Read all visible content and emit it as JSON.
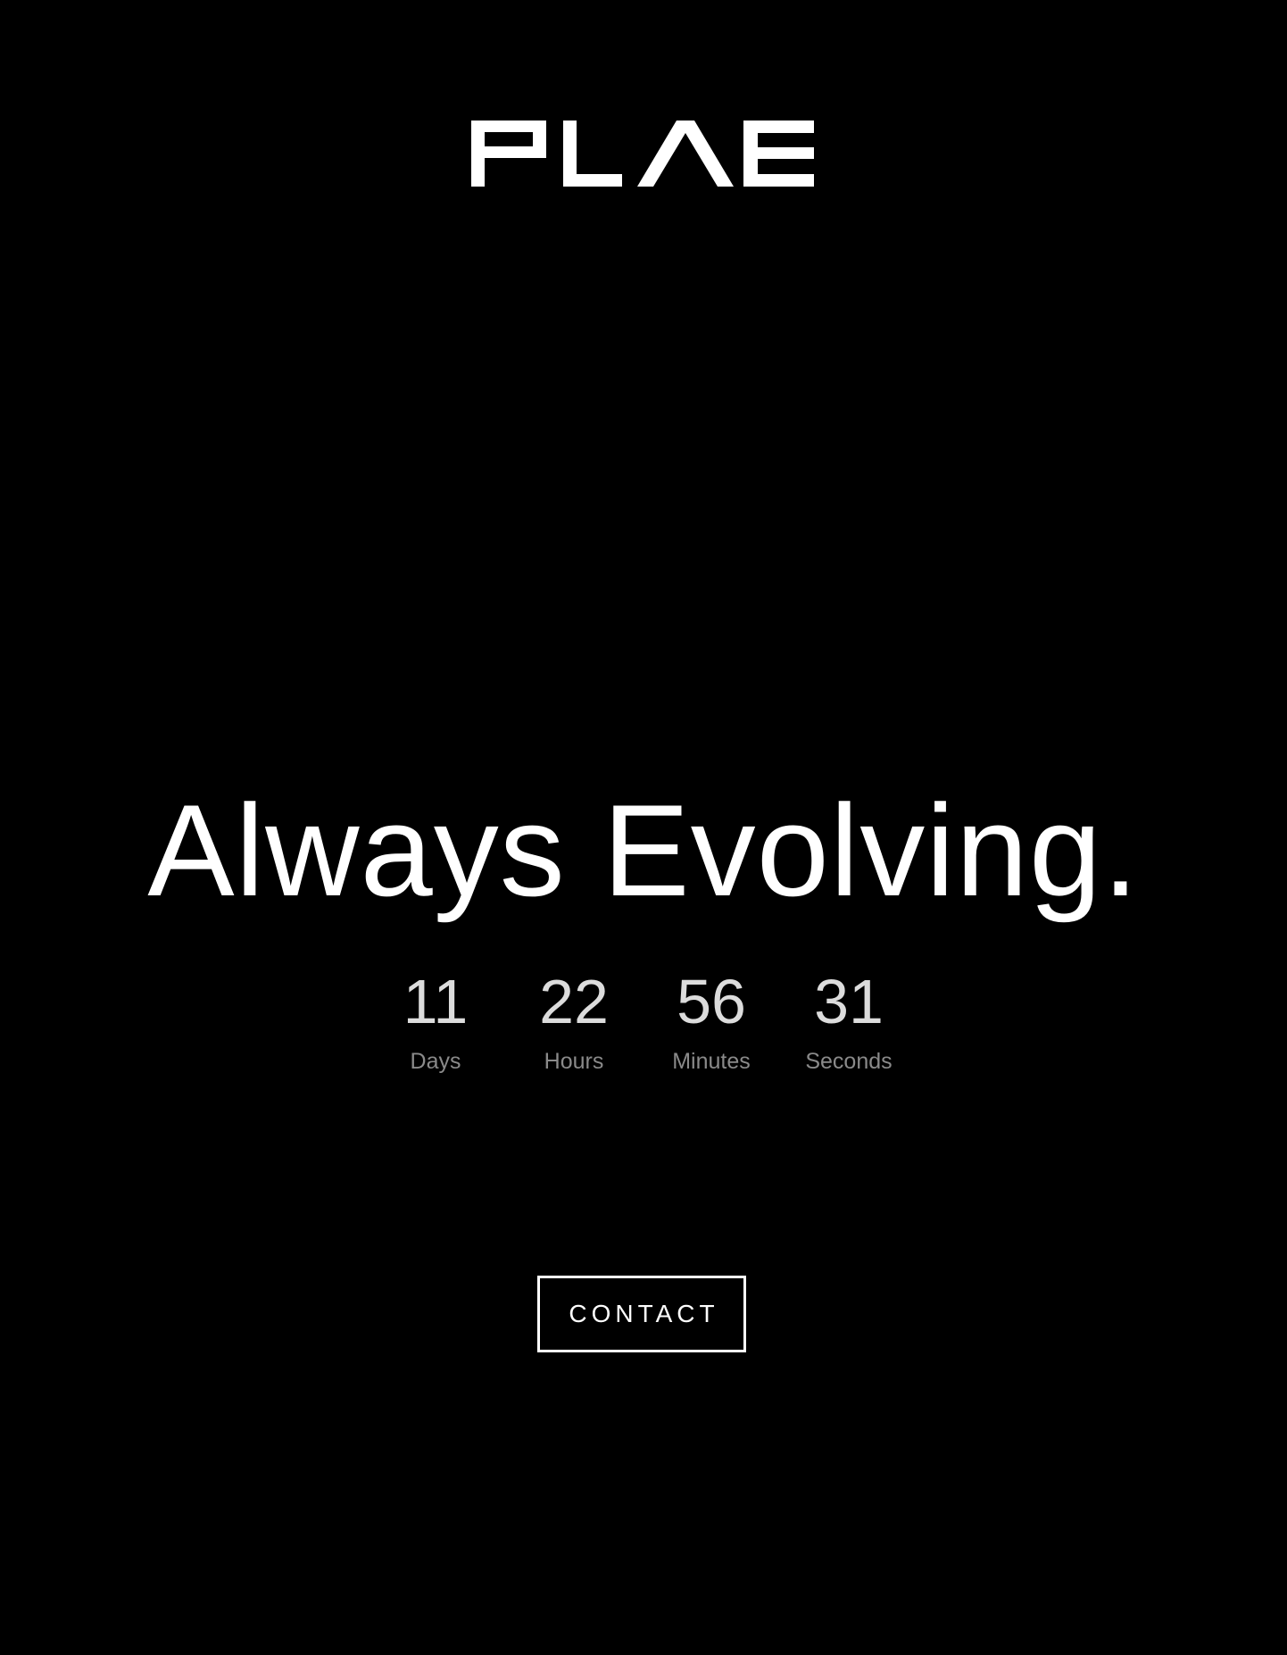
{
  "brand": {
    "logo_text": "PLAE",
    "logo_color": "#ffffff"
  },
  "hero": {
    "headline": "Always Evolving."
  },
  "countdown": {
    "days": {
      "value": "11",
      "label": "Days"
    },
    "hours": {
      "value": "22",
      "label": "Hours"
    },
    "minutes": {
      "value": "56",
      "label": "Minutes"
    },
    "seconds": {
      "value": "31",
      "label": "Seconds"
    }
  },
  "cta": {
    "contact_label": "CONTACT"
  },
  "colors": {
    "background": "#000000",
    "text_primary": "#ffffff",
    "countdown_number": "#dcdcdc",
    "countdown_label": "#8a8a8a"
  }
}
